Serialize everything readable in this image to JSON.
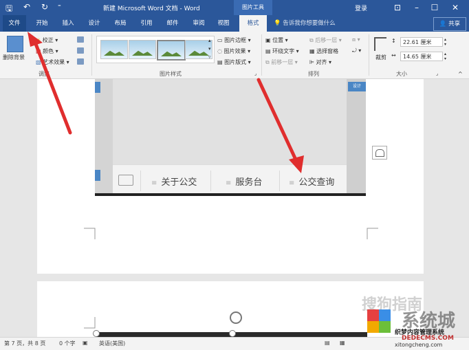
{
  "titlebar": {
    "title": "新建 Microsoft Word 文档 - Word",
    "context_tab": "图片工具",
    "login": "登录",
    "save_icon": "save-icon",
    "undo_icon": "undo-icon",
    "redo_icon": "redo-icon"
  },
  "tabs": [
    {
      "label": "文件"
    },
    {
      "label": "开始"
    },
    {
      "label": "插入"
    },
    {
      "label": "设计"
    },
    {
      "label": "布局"
    },
    {
      "label": "引用"
    },
    {
      "label": "邮件"
    },
    {
      "label": "审阅"
    },
    {
      "label": "视图"
    },
    {
      "label": "格式"
    }
  ],
  "tell_me": "告诉我你想要做什么",
  "share": "共享",
  "ribbon": {
    "remove_bg": "删除背景",
    "adjust": {
      "correct": "校正",
      "color": "颜色",
      "art": "艺术效果",
      "label": "调整"
    },
    "styles": {
      "border": "图片边框",
      "effects": "图片效果",
      "layout": "图片版式",
      "label": "图片样式"
    },
    "arrange": {
      "position": "位置",
      "wrap": "环绕文字",
      "forward": "前移一层",
      "backward": "后移一层",
      "pane": "选择窗格",
      "align": "对齐",
      "label": "排列"
    },
    "size": {
      "crop": "裁剪",
      "height": "22.61 厘米",
      "width": "14.65 厘米",
      "label": "大小"
    }
  },
  "document": {
    "nav_items": [
      "关于公交",
      "服务台",
      "公交查询"
    ],
    "top_right_badge": "设计"
  },
  "status": {
    "page": "第 7 页，共 8 页",
    "words": "0 个字",
    "lang": "英语(美国)"
  },
  "watermarks": {
    "sogou": "搜狗指南",
    "xitong": "系统城",
    "site1": "织梦内容管理系统",
    "site2": "DEDECMS.COM",
    "site3": "xitongcheng.com"
  },
  "colors": {
    "accent": "#2b579a",
    "arrow": "#e02e2e"
  }
}
